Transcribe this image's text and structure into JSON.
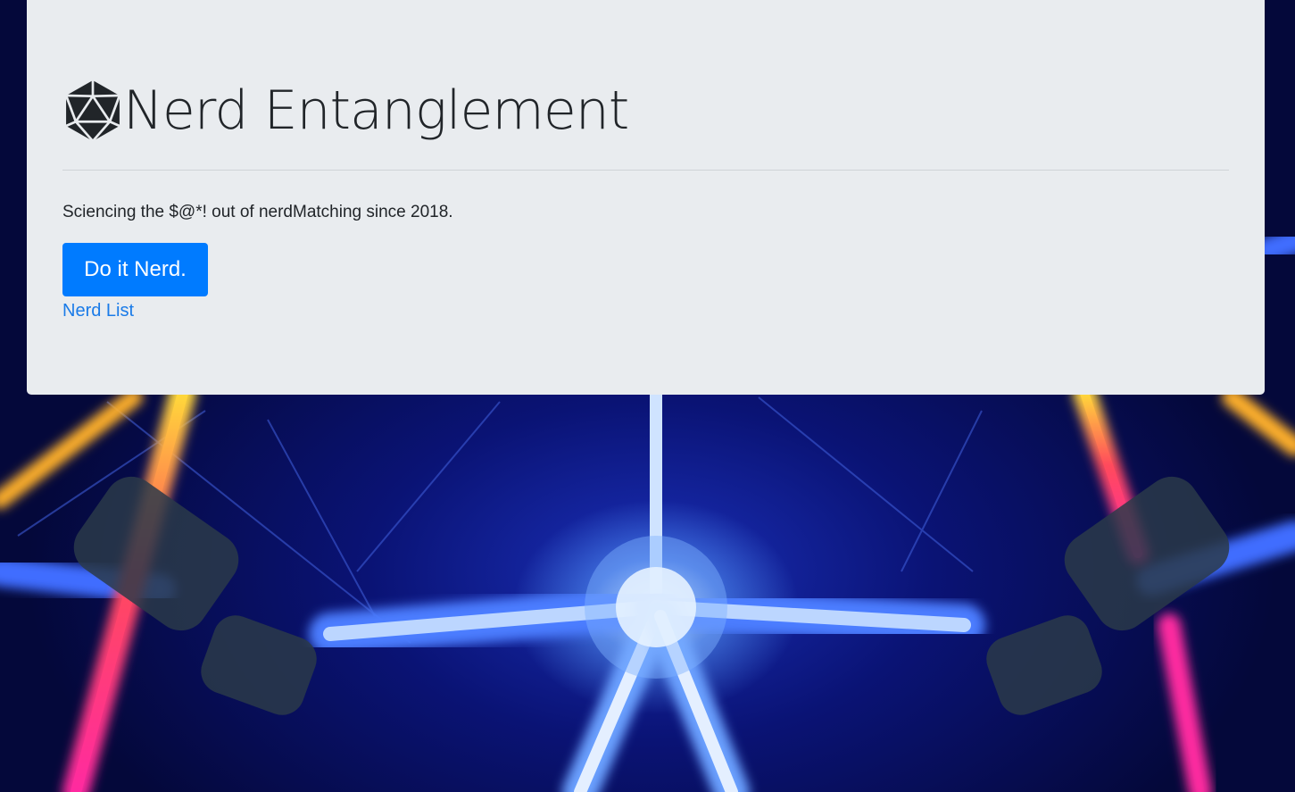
{
  "hero": {
    "logo_icon": "d20-dice-icon",
    "title": "Nerd Entanglement",
    "tagline": "Sciencing the $@*! out of nerdMatching since 2018.",
    "cta_label": "Do it Nerd.",
    "nerd_list_link": "Nerd List"
  },
  "colors": {
    "jumbotron_bg": "#e9ecef",
    "primary_button": "#007bff",
    "link": "#1a7be8",
    "text": "#212529",
    "background_dark": "#03062e"
  },
  "background_image": "neon-glowing-tube-sculpture"
}
